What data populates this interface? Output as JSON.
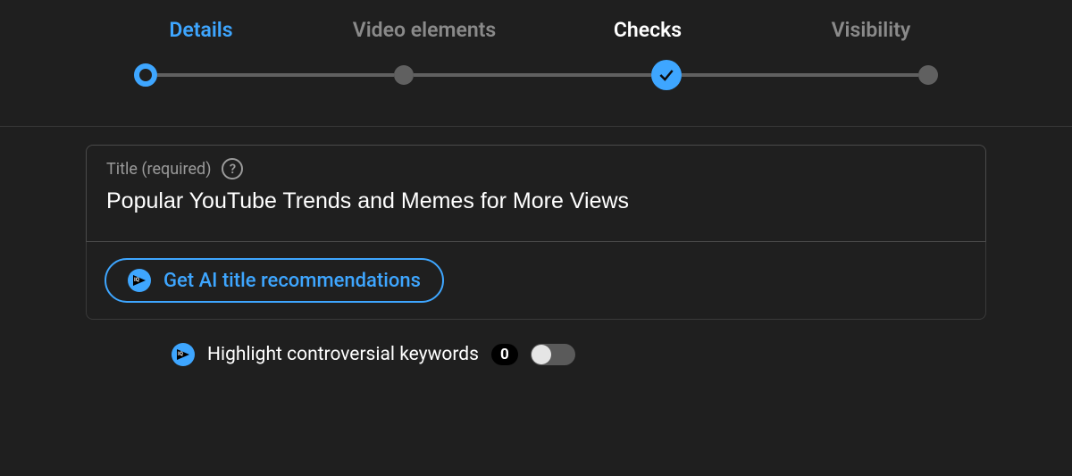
{
  "stepper": {
    "steps": [
      {
        "label": "Details",
        "state": "active-blue"
      },
      {
        "label": "Video elements",
        "state": "inactive"
      },
      {
        "label": "Checks",
        "state": "completed"
      },
      {
        "label": "Visibility",
        "state": "inactive"
      }
    ]
  },
  "title_field": {
    "label": "Title (required)",
    "value": "Popular YouTube Trends and Memes for More Views",
    "help_glyph": "?"
  },
  "ai_button": {
    "label": "Get AI title recommendations",
    "icon_text": "IQ"
  },
  "highlight_toggle": {
    "label": "Highlight controversial keywords",
    "count": "0",
    "enabled": false,
    "icon_text": "IQ"
  },
  "colors": {
    "accent": "#3ea6ff",
    "bg": "#1f1f1f",
    "muted": "#8a8a8a"
  }
}
